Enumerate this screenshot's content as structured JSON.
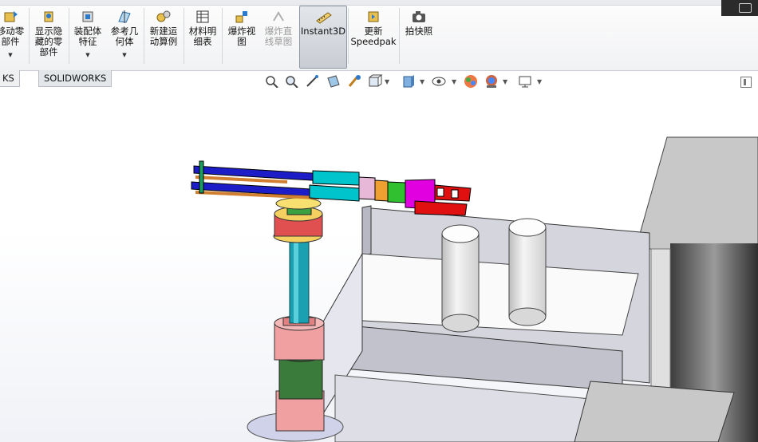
{
  "ribbon": {
    "buttons": [
      {
        "label": "移动零\n部件",
        "icon": "move-component-icon",
        "dropdown": true,
        "disabled": false,
        "active": false
      },
      {
        "label": "显示隐\n藏的零\n部件",
        "icon": "show-hidden-components-icon",
        "dropdown": false,
        "disabled": false,
        "active": false
      },
      {
        "label": "装配体\n特征",
        "icon": "assembly-features-icon",
        "dropdown": true,
        "disabled": false,
        "active": false
      },
      {
        "label": "参考几\n何体",
        "icon": "reference-geometry-icon",
        "dropdown": true,
        "disabled": false,
        "active": false
      },
      {
        "label": "新建运\n动算例",
        "icon": "new-motion-study-icon",
        "dropdown": false,
        "disabled": false,
        "active": false
      },
      {
        "label": "材料明\n细表",
        "icon": "bill-of-materials-icon",
        "dropdown": false,
        "disabled": false,
        "active": false
      },
      {
        "label": "爆炸视\n图",
        "icon": "exploded-view-icon",
        "dropdown": false,
        "disabled": false,
        "active": false
      },
      {
        "label": "爆炸直\n线草图",
        "icon": "explode-line-sketch-icon",
        "dropdown": false,
        "disabled": true,
        "active": false
      },
      {
        "label": "Instant3D",
        "icon": "instant3d-icon",
        "dropdown": false,
        "disabled": false,
        "active": true
      },
      {
        "label": "更新\nSpeedpak",
        "icon": "update-speedpak-icon",
        "dropdown": false,
        "disabled": false,
        "active": false
      },
      {
        "label": "拍快照",
        "icon": "snapshot-camera-icon",
        "dropdown": false,
        "disabled": false,
        "active": false
      }
    ]
  },
  "tabs": [
    {
      "label": "KS 插件"
    },
    {
      "label": "SOLIDWORKS MBD"
    }
  ],
  "heads_up_toolbar": [
    "zoom-to-fit-icon",
    "zoom-to-area-icon",
    "previous-view-icon",
    "section-view-icon",
    "dynamic-annotation-views-icon",
    "view-orientation-icon",
    "display-style-icon",
    "hide-show-items-icon",
    "edit-appearance-icon",
    "apply-scene-icon",
    "view-settings-icon"
  ],
  "colors": {
    "accent": "#0a64c8",
    "arm_blue": "#1d1dc8",
    "arm_cyan": "#00c4cc",
    "gripper_red": "#e01010",
    "gripper_magenta": "#e000e0",
    "column_teal": "#1aa0b0",
    "base_pink": "#f0a0a0",
    "base_green": "#3a7a3a"
  }
}
